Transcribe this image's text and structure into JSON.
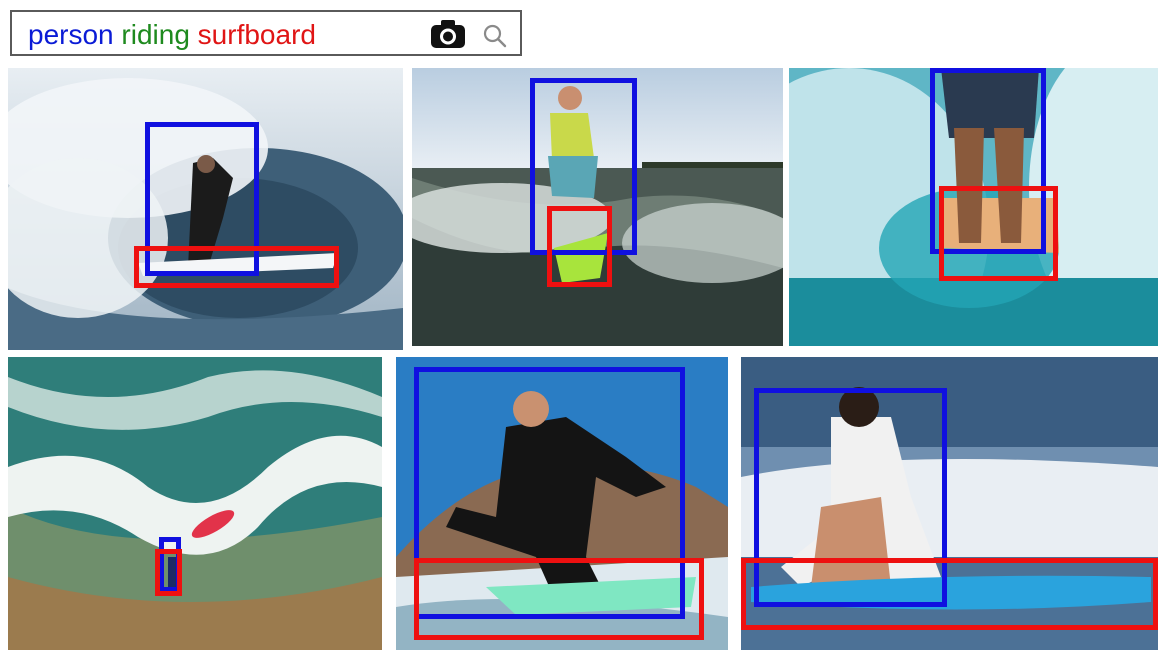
{
  "search": {
    "query_terms": [
      {
        "text": "person",
        "color": "#0a1bd6"
      },
      {
        "text": "riding",
        "color": "#1e8a1e"
      },
      {
        "text": "surfboard",
        "color": "#e01515"
      }
    ],
    "camera_icon": "camera-icon",
    "search_icon": "search-icon"
  },
  "colors": {
    "subject_box": "#1010e0",
    "object_box": "#ee1010"
  },
  "results": [
    {
      "id": 1,
      "boxes": [
        "person",
        "surfboard"
      ]
    },
    {
      "id": 2,
      "boxes": [
        "person",
        "surfboard"
      ]
    },
    {
      "id": 3,
      "boxes": [
        "person",
        "surfboard"
      ]
    },
    {
      "id": 4,
      "boxes": [
        "person",
        "surfboard"
      ]
    },
    {
      "id": 5,
      "boxes": [
        "person",
        "surfboard"
      ]
    },
    {
      "id": 6,
      "boxes": [
        "person",
        "surfboard"
      ]
    }
  ]
}
